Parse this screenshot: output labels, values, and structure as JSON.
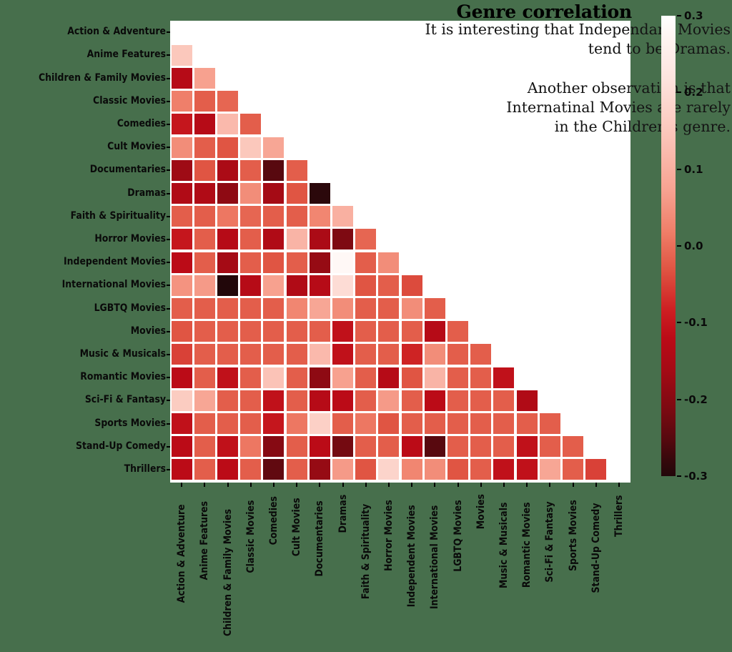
{
  "figure": {
    "title": "Genre correlation",
    "background_color": "#476F4C",
    "plot_background_color": "#ffffff",
    "annotation": "It is interesting that Independant Movies\ntend to be Dramas.\n\nAnother observation is that\nInternatinal Movies are rarely\nin the Children's genre."
  },
  "colorbar": {
    "ticks": [
      "0.3",
      "0.2",
      "0.1",
      "0.0",
      "-0.1",
      "-0.2",
      "-0.3"
    ],
    "tick_values": [
      0.3,
      0.2,
      0.1,
      0.0,
      -0.1,
      -0.2,
      -0.3
    ],
    "vmin": -0.3,
    "vmax": 0.3,
    "low_color": "#1c0609",
    "mid_color": "#c4101b",
    "high_color": "#ffffff"
  },
  "chart_data": {
    "type": "heatmap",
    "title": "Genre correlation",
    "xlabel": "",
    "ylabel": "",
    "grid": false,
    "legend_position": "right",
    "mask": "upper-triangle-hidden",
    "vmin": -0.3,
    "vmax": 0.3,
    "categories": [
      "Action & Adventure",
      "Anime Features",
      "Children & Family Movies",
      "Classic Movies",
      "Comedies",
      "Cult Movies",
      "Documentaries",
      "Dramas",
      "Faith & Spirituality",
      "Horror Movies",
      "Independent Movies",
      "International Movies",
      "LGBTQ Movies",
      "Movies",
      "Music & Musicals",
      "Romantic Movies",
      "Sci-Fi & Fantasy",
      "Sports Movies",
      "Stand-Up Comedy",
      "Thrillers"
    ],
    "x_tick_labels": [
      "Action & Adventure",
      "Anime Features",
      "Children & Family Movies",
      "Classic Movies",
      "Comedies",
      "Cult Movies",
      "Documentaries",
      "Dramas",
      "Faith & Spirituality",
      "Horror Movies",
      "Independent Movies",
      "International Movies",
      "LGBTQ Movies",
      "Movies",
      "Music & Musicals",
      "Romantic Movies",
      "Sci-Fi & Fantasy",
      "Sports Movies",
      "Stand-Up Comedy",
      "Thrillers"
    ],
    "y_tick_labels": [
      "Action & Adventure",
      "Anime Features",
      "Children & Family Movies",
      "Classic Movies",
      "Comedies",
      "Cult Movies",
      "Documentaries",
      "Dramas",
      "Faith & Spirituality",
      "Horror Movies",
      "Independent Movies",
      "International Movies",
      "LGBTQ Movies",
      "Movies",
      "Music & Musicals",
      "Romantic Movies",
      "Sci-Fi & Fantasy",
      "Sports Movies",
      "Stand-Up Comedy",
      "Thrillers"
    ],
    "values": [
      [
        null,
        null,
        null,
        null,
        null,
        null,
        null,
        null,
        null,
        null,
        null,
        null,
        null,
        null,
        null,
        null,
        null,
        null,
        null,
        null
      ],
      [
        0.15,
        null,
        null,
        null,
        null,
        null,
        null,
        null,
        null,
        null,
        null,
        null,
        null,
        null,
        null,
        null,
        null,
        null,
        null,
        null
      ],
      [
        -0.13,
        0.07,
        null,
        null,
        null,
        null,
        null,
        null,
        null,
        null,
        null,
        null,
        null,
        null,
        null,
        null,
        null,
        null,
        null,
        null
      ],
      [
        0.02,
        -0.02,
        -0.01,
        null,
        null,
        null,
        null,
        null,
        null,
        null,
        null,
        null,
        null,
        null,
        null,
        null,
        null,
        null,
        null,
        null
      ],
      [
        -0.1,
        -0.13,
        0.12,
        -0.02,
        null,
        null,
        null,
        null,
        null,
        null,
        null,
        null,
        null,
        null,
        null,
        null,
        null,
        null,
        null,
        null
      ],
      [
        0.04,
        -0.02,
        -0.03,
        0.15,
        0.08,
        null,
        null,
        null,
        null,
        null,
        null,
        null,
        null,
        null,
        null,
        null,
        null,
        null,
        null,
        null
      ],
      [
        -0.17,
        -0.03,
        -0.15,
        -0.02,
        -0.25,
        -0.02,
        null,
        null,
        null,
        null,
        null,
        null,
        null,
        null,
        null,
        null,
        null,
        null,
        null,
        null
      ],
      [
        -0.14,
        -0.14,
        -0.19,
        0.04,
        -0.16,
        -0.03,
        -0.29,
        null,
        null,
        null,
        null,
        null,
        null,
        null,
        null,
        null,
        null,
        null,
        null,
        null
      ],
      [
        -0.02,
        -0.02,
        0.01,
        -0.01,
        -0.02,
        -0.02,
        0.03,
        0.1,
        null,
        null,
        null,
        null,
        null,
        null,
        null,
        null,
        null,
        null,
        null,
        null
      ],
      [
        -0.1,
        -0.02,
        -0.13,
        -0.02,
        -0.14,
        0.11,
        -0.15,
        -0.21,
        -0.01,
        null,
        null,
        null,
        null,
        null,
        null,
        null,
        null,
        null,
        null,
        null
      ],
      [
        -0.12,
        -0.02,
        -0.16,
        -0.02,
        -0.03,
        -0.02,
        -0.18,
        0.28,
        -0.02,
        0.04,
        null,
        null,
        null,
        null,
        null,
        null,
        null,
        null,
        null,
        null
      ],
      [
        0.05,
        0.06,
        -0.3,
        -0.13,
        0.07,
        -0.14,
        -0.13,
        0.2,
        -0.03,
        -0.02,
        -0.04,
        null,
        null,
        null,
        null,
        null,
        null,
        null,
        null,
        null
      ],
      [
        -0.02,
        -0.02,
        -0.02,
        -0.02,
        -0.02,
        0.03,
        0.08,
        0.04,
        -0.02,
        -0.02,
        0.04,
        -0.02,
        null,
        null,
        null,
        null,
        null,
        null,
        null,
        null
      ],
      [
        -0.03,
        -0.02,
        -0.02,
        -0.02,
        -0.02,
        -0.02,
        -0.02,
        -0.11,
        -0.02,
        -0.02,
        -0.02,
        -0.13,
        -0.02,
        null,
        null,
        null,
        null,
        null,
        null,
        null
      ],
      [
        -0.05,
        -0.02,
        -0.02,
        -0.02,
        -0.02,
        -0.02,
        0.12,
        -0.11,
        -0.02,
        -0.02,
        -0.08,
        0.04,
        -0.02,
        -0.02,
        null,
        null,
        null,
        null,
        null,
        null
      ],
      [
        -0.12,
        -0.02,
        -0.11,
        -0.02,
        0.14,
        -0.02,
        -0.19,
        0.07,
        -0.02,
        -0.13,
        -0.03,
        0.11,
        -0.02,
        -0.02,
        -0.11,
        null,
        null,
        null,
        null,
        null
      ],
      [
        0.16,
        0.08,
        -0.02,
        -0.02,
        -0.11,
        -0.02,
        -0.13,
        -0.12,
        -0.02,
        0.06,
        -0.02,
        -0.12,
        -0.02,
        -0.02,
        -0.02,
        -0.14,
        null,
        null,
        null,
        null
      ],
      [
        -0.11,
        -0.02,
        -0.02,
        -0.02,
        -0.1,
        0.01,
        0.17,
        -0.02,
        0.01,
        -0.03,
        -0.02,
        -0.02,
        -0.02,
        -0.02,
        -0.02,
        -0.02,
        -0.02,
        null,
        null,
        null
      ],
      [
        -0.12,
        -0.02,
        -0.11,
        0.01,
        -0.2,
        -0.02,
        -0.12,
        -0.22,
        -0.02,
        -0.02,
        -0.12,
        -0.25,
        -0.02,
        -0.02,
        -0.02,
        -0.11,
        -0.02,
        -0.02,
        null,
        null
      ],
      [
        -0.12,
        -0.02,
        -0.12,
        -0.02,
        -0.24,
        -0.02,
        -0.18,
        0.06,
        -0.03,
        0.18,
        0.03,
        0.04,
        -0.03,
        -0.02,
        -0.11,
        -0.11,
        0.08,
        -0.02,
        -0.05,
        null
      ]
    ]
  }
}
